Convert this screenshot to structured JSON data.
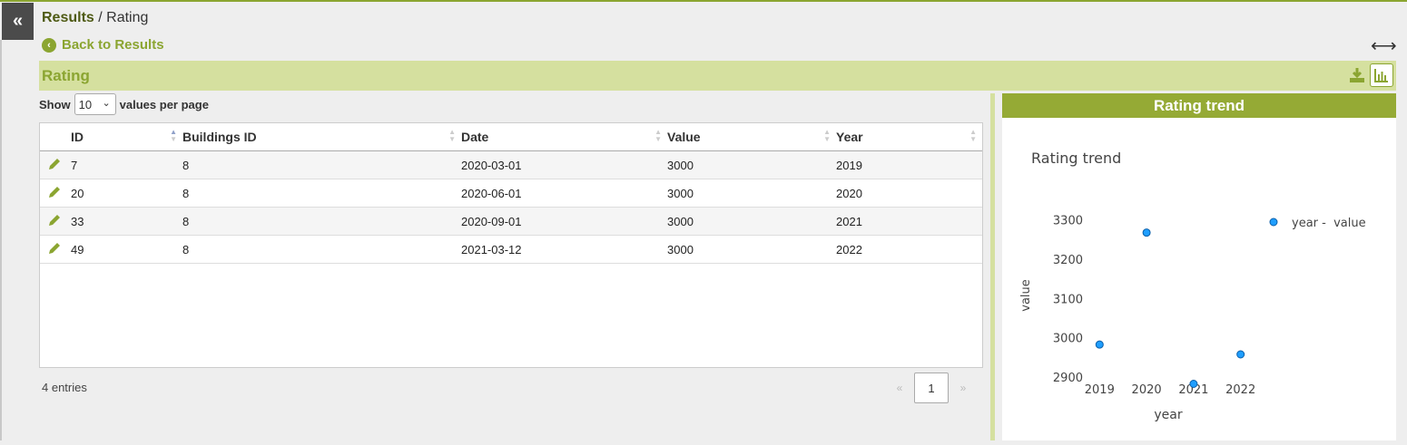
{
  "breadcrumb": {
    "root": "Results",
    "separator": "/",
    "current": "Rating"
  },
  "back_link": "Back to Results",
  "panel": {
    "title": "Rating"
  },
  "show": {
    "label": "Show",
    "value": "10",
    "suffix": "values per page"
  },
  "table": {
    "columns": [
      "ID",
      "Buildings ID",
      "Date",
      "Value",
      "Year"
    ],
    "rows": [
      [
        "7",
        "8",
        "2020-03-01",
        "3000",
        "2019"
      ],
      [
        "20",
        "8",
        "2020-06-01",
        "3000",
        "2020"
      ],
      [
        "33",
        "8",
        "2020-09-01",
        "3000",
        "2021"
      ],
      [
        "49",
        "8",
        "2021-03-12",
        "3000",
        "2022"
      ]
    ]
  },
  "footer": {
    "entries": "4 entries",
    "page": "1",
    "prev": "«",
    "next": "»"
  },
  "chart_panel": {
    "header": "Rating trend"
  },
  "chart_data": {
    "type": "scatter",
    "title": "Rating trend",
    "xlabel": "year",
    "ylabel": "value",
    "x": [
      2019,
      2020,
      2021,
      2022
    ],
    "x_tick_labels": [
      "2019",
      "2020",
      "2021",
      "2022"
    ],
    "y_ticks": [
      2900,
      3000,
      3100,
      3200,
      3300
    ],
    "y_tick_labels": [
      "2900",
      "3000",
      "3100",
      "3200",
      "3300"
    ],
    "series": [
      {
        "name": "year -  value",
        "color": "#1f9eff",
        "x": [
          2019,
          2020,
          2021,
          2022
        ],
        "y": [
          2985,
          3270,
          2885,
          2960
        ]
      }
    ],
    "xlim": [
      2018.55,
      2022.45
    ],
    "ylim": [
      2870,
      3320
    ],
    "grid": false,
    "legend": "top-right"
  },
  "colors": {
    "accent": "#8ba531",
    "header_bg": "#d5e09f",
    "chart_header": "#95aa35",
    "marker": "#1f9eff"
  }
}
